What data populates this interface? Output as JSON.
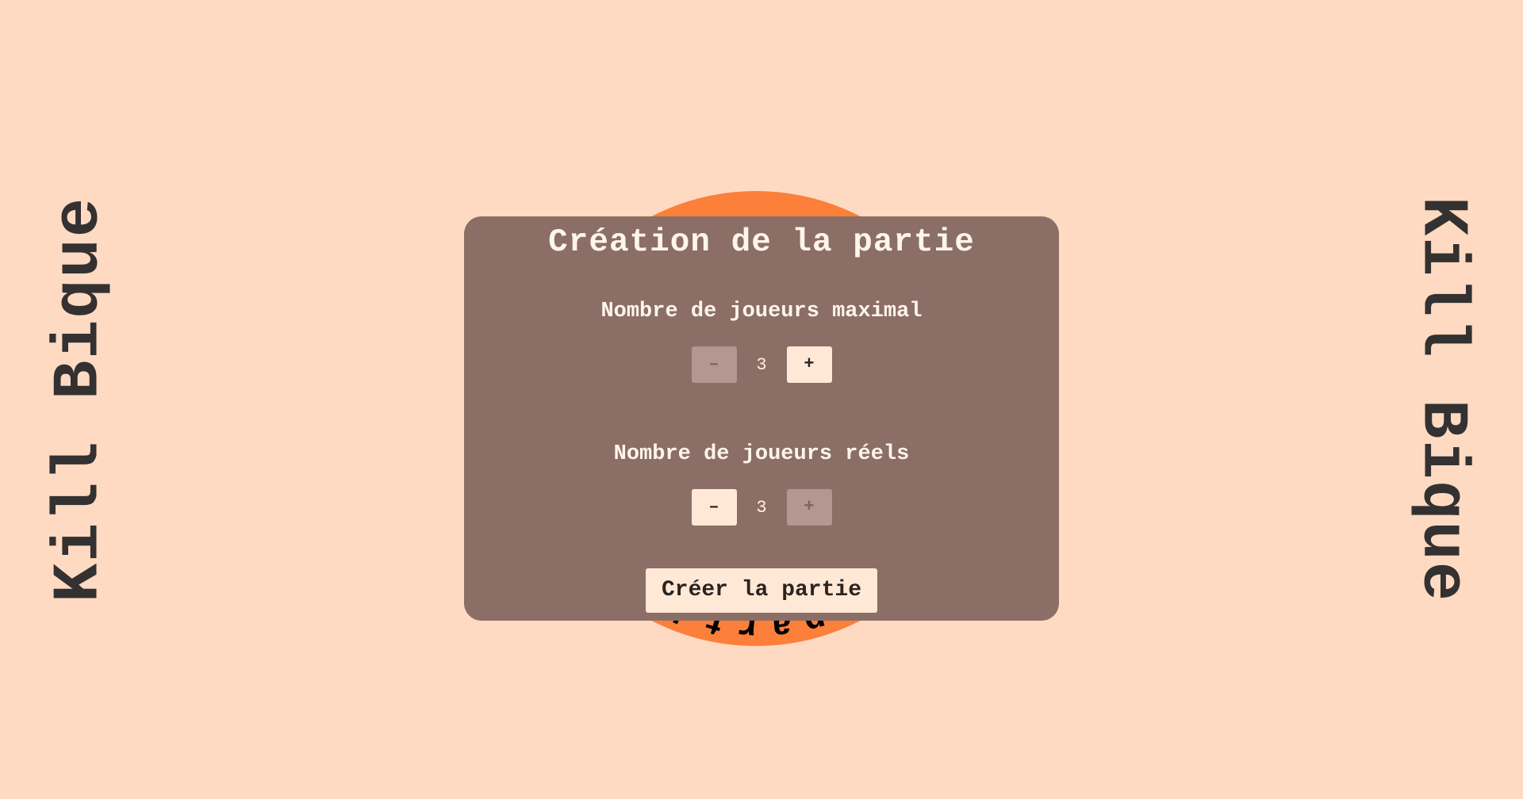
{
  "app": {
    "brand_left": "Kill Bique",
    "brand_right": "Kill Bique"
  },
  "rotating_badge": {
    "text": "Nouvelle partie ● Nouvelle partie ● ",
    "circle_color": "#FC7F3A",
    "text_color": "#000000"
  },
  "dialog": {
    "title": "Création de la partie",
    "max_players": {
      "label": "Nombre de joueurs maximal",
      "value": "3",
      "minus_label": "–",
      "plus_label": "+",
      "minus_enabled": false,
      "plus_enabled": true
    },
    "real_players": {
      "label": "Nombre de joueurs réels",
      "value": "3",
      "minus_label": "–",
      "plus_label": "+",
      "minus_enabled": true,
      "plus_enabled": false
    },
    "create_button": "Créer la partie"
  },
  "colors": {
    "background": "#FFDAC2",
    "dialog": "#8B6E65",
    "button": "#FFE9D6",
    "button_disabled": "#B39790",
    "accent": "#FC7F3A"
  }
}
